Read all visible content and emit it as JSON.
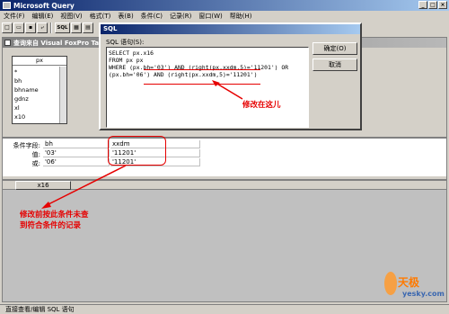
{
  "app": {
    "title": "Microsoft Query"
  },
  "menu": [
    "文件(F)",
    "编辑(E)",
    "视图(V)",
    "格式(T)",
    "表(B)",
    "条件(C)",
    "记录(R)",
    "窗口(W)",
    "帮助(H)"
  ],
  "toolbar": {
    "sql_label": "SQL"
  },
  "query_window": {
    "title": "查询来自 Visual FoxPro Ta"
  },
  "table": {
    "name": "px",
    "fields": [
      "*",
      "bh",
      "bhname",
      "gdnz",
      "xl",
      "x10"
    ]
  },
  "criteria": {
    "labels": {
      "field": "条件字段:",
      "value": "值:",
      "or": "或:"
    },
    "columns": [
      {
        "field": "bh",
        "value": "'03'",
        "or": "'06'"
      },
      {
        "field": "xxdm",
        "value": "'11201'",
        "or": "'11201'"
      }
    ]
  },
  "results": {
    "columns": [
      "x16"
    ]
  },
  "sql_dialog": {
    "title": "SQL",
    "label": "SQL 语句(S):",
    "text": "SELECT px.x16\nFROM px px\nWHERE (px.bh='03') AND (right(px.xxdm,5)='11201') OR\n(px.bh='06') AND (right(px.xxdm,5)='11201')",
    "ok_label": "确定(O)",
    "cancel_label": "取消"
  },
  "annotations": {
    "sql_note": "修改在这儿",
    "criteria_note_line1": "修改前按此条件未查",
    "criteria_note_line2": "到符合条件的记录",
    "accent": "#e60000"
  },
  "status": {
    "text": "直接查看/编辑 SQL 语句"
  },
  "watermark": {
    "brand": "天极",
    "site": "yesky.com"
  }
}
